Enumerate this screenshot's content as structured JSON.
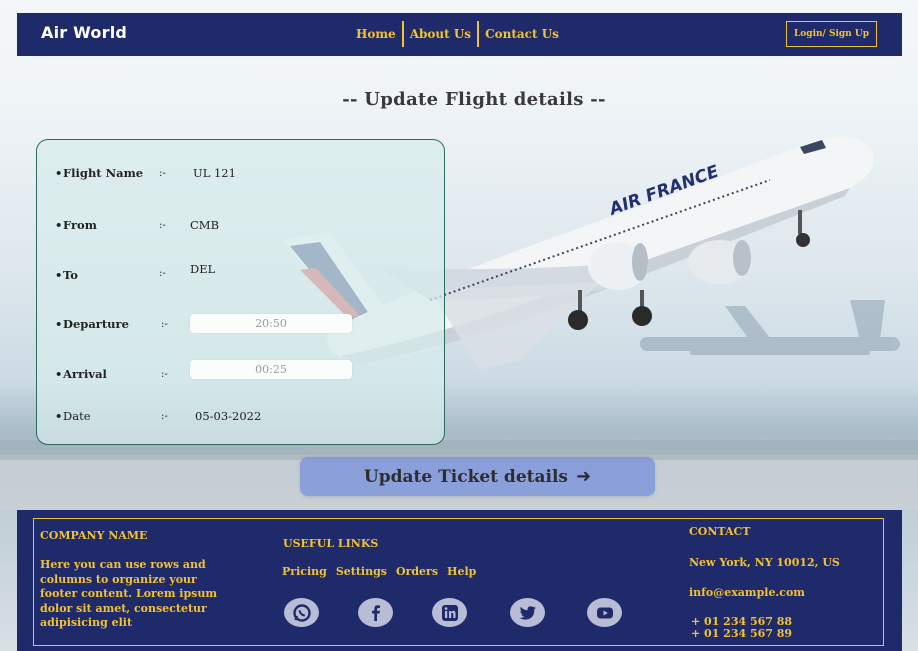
{
  "brand": "Air World",
  "nav": {
    "home": "Home",
    "about": "About Us",
    "contact": "Contact Us",
    "login": "Login/ Sign Up"
  },
  "page_title": "-- Update Flight details --",
  "flight": {
    "name_label": "Flight Name",
    "name_value": "UL 121",
    "from_label": "From",
    "from_value": "CMB",
    "to_label": "To",
    "to_value": "DEL",
    "departure_label": "Departure",
    "departure_value": "20:50",
    "arrival_label": "Arrival",
    "arrival_value": "00:25",
    "date_label": "Date",
    "date_value": "05-03-2022",
    "separator": ":-"
  },
  "update_button": "Update Ticket details",
  "aircraft_livery": "AIR FRANCE",
  "footer": {
    "company_heading": "COMPANY NAME",
    "company_text_lines": [
      "Here you can use rows and",
      "columns to organize your",
      "footer content. Lorem ipsum",
      "dolor sit amet, consectetur",
      "adipisicing elit"
    ],
    "links_heading": "USEFUL LINKS",
    "links": [
      "Pricing",
      "Settings",
      "Orders",
      "Help"
    ],
    "contact_heading": "CONTACT",
    "address": "New York, NY 10012, US",
    "email": "info@example.com",
    "phones": [
      "+ 01 234 567 88",
      "+ 01 234 567 89"
    ],
    "social_icons": [
      "whatsapp-icon",
      "facebook-icon",
      "linkedin-icon",
      "twitter-icon",
      "youtube-icon"
    ]
  },
  "colors": {
    "navy": "#1f2a6b",
    "gold": "#f2c230",
    "button": "#7a92dc"
  }
}
